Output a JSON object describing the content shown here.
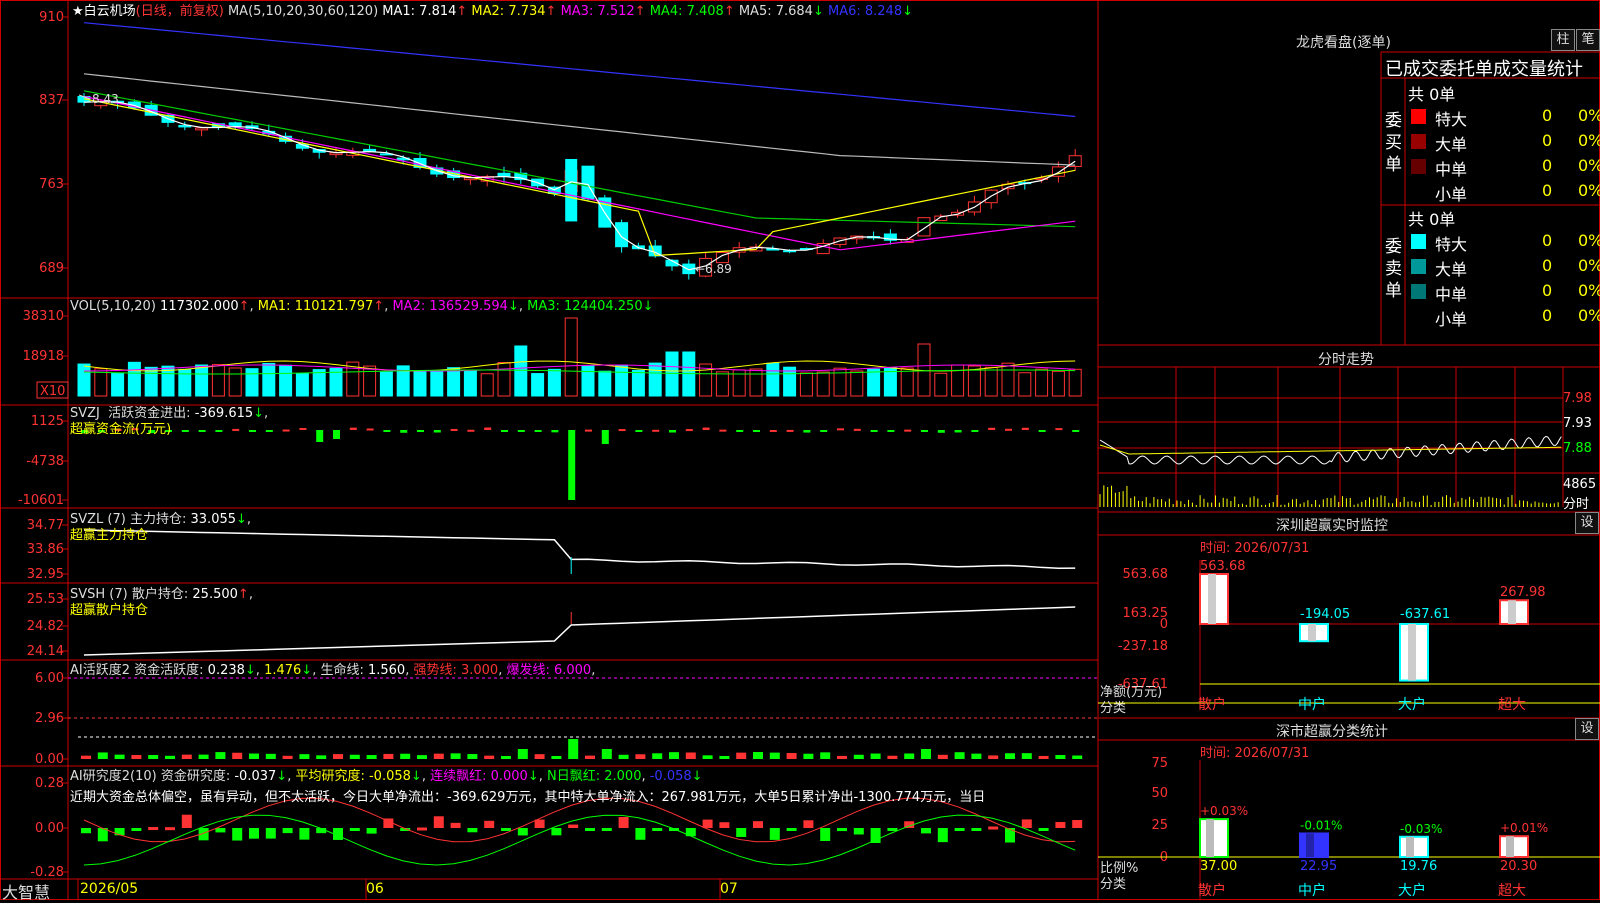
{
  "stock": {
    "title_star": "★",
    "name": "白云机场",
    "mode": "(日线，前复权)",
    "ma_label": "MA(5,10,20,30,60,120)",
    "ma_values": [
      {
        "label": "MA1:",
        "value": "7.814",
        "arrow": "↑",
        "color": "#ffffff"
      },
      {
        "label": "MA2:",
        "value": "7.734",
        "arrow": "↑",
        "color": "#ffff00"
      },
      {
        "label": "MA3:",
        "value": "7.512",
        "arrow": "↑",
        "color": "#ff00ff"
      },
      {
        "label": "MA4:",
        "value": "7.408",
        "arrow": "↑",
        "color": "#00ff00"
      },
      {
        "label": "MA5:",
        "value": "7.684",
        "arrow": "↓",
        "color": "#dddddd"
      },
      {
        "label": "MA6:",
        "value": "8.248",
        "arrow": "↓",
        "color": "#3333ff"
      }
    ],
    "y_ticks": [
      "910",
      "837",
      "763",
      "689"
    ],
    "high_mark": "8.43",
    "low_mark": "6.89"
  },
  "volume": {
    "header": "VOL(5,10,20)",
    "value": "117302.000",
    "ma1": "110121.797",
    "ma2": "136529.594",
    "ma3": "124404.250",
    "y_ticks": [
      "38310",
      "18918"
    ],
    "unit": "X10"
  },
  "svzj": {
    "header": "SVZJ",
    "label": "活跃资金进出:",
    "value": "-369.615",
    "sub": "超赢资金流(万元)",
    "y_ticks": [
      "1125",
      "-4738",
      "-10601"
    ]
  },
  "svzl": {
    "header": "SVZL (7)",
    "label": "主力持仓:",
    "value": "33.055",
    "sub": "超赢主力持仓",
    "y_ticks": [
      "34.77",
      "33.86",
      "32.95"
    ]
  },
  "svsh": {
    "header": "SVSH (7)",
    "label": "散户持仓:",
    "value": "25.500",
    "sub": "超赢散户持仓",
    "y_ticks": [
      "25.53",
      "24.82",
      "24.14"
    ]
  },
  "ai_active": {
    "header": "AI活跃度2",
    "label": "资金活跃度:",
    "v1": "0.238",
    "v2": "1.476",
    "life_label": "生命线:",
    "life": "1.560",
    "strong": "强势线: 3.000",
    "burst": "爆发线: 6.000",
    "y_ticks": [
      "6.00",
      "2.96",
      "0.00"
    ]
  },
  "ai_research": {
    "header": "AI研究度2(10)",
    "label": "资金研究度:",
    "v1": "-0.037",
    "avg_label": "平均研究度:",
    "avg": "-0.058",
    "red_label": "连续飘红:",
    "red": "0.000",
    "n_label": "N日飘红:",
    "n1": "2.000",
    "n2": "-0.058",
    "comment": "近期大资金总体偏空，虽有异动，但不太活跃，今日大单净流出：-369.629万元，其中特大单净流入：267.981万元，大单5日累计净出-1300.774万元，当日",
    "y_ticks": [
      "0.28",
      "0.00",
      "-0.28"
    ]
  },
  "bottom_bar": {
    "brand": "大智慧",
    "dates": [
      "2026/05",
      "06",
      "07"
    ]
  },
  "dragon": {
    "title": "龙虎看盘(逐单)",
    "btn1": "柱",
    "btn2": "笔",
    "subtitle": "已成交委托单成交量统计",
    "buy": {
      "side": "委买单",
      "total": "共 0单",
      "rows": [
        {
          "name": "特大",
          "count": "0",
          "pct": "0%",
          "color": "#ff0000"
        },
        {
          "name": "大单",
          "count": "0",
          "pct": "0%",
          "color": "#990000"
        },
        {
          "name": "中单",
          "count": "0",
          "pct": "0%",
          "color": "#660000"
        },
        {
          "name": "小单",
          "count": "0",
          "pct": "0%",
          "color": "#000000"
        }
      ]
    },
    "sell": {
      "side": "委卖单",
      "total": "共 0单",
      "rows": [
        {
          "name": "特大",
          "count": "0",
          "pct": "0%",
          "color": "#00ffff"
        },
        {
          "name": "大单",
          "count": "0",
          "pct": "0%",
          "color": "#009999"
        },
        {
          "name": "中单",
          "count": "0",
          "pct": "0%",
          "color": "#007777"
        },
        {
          "name": "小单",
          "count": "0",
          "pct": "0%",
          "color": "#000000"
        }
      ]
    }
  },
  "intraday": {
    "title": "分时走势",
    "prices": [
      "7.98",
      "7.93",
      "7.88"
    ],
    "vol": "4865",
    "vol_label": "分时"
  },
  "monitor": {
    "title": "深圳超赢实时监控",
    "btn": "设",
    "time": "时间: 2026/07/31",
    "y_ticks": [
      "563.68",
      "163.25",
      "0",
      "-237.18",
      "-637.61"
    ],
    "y_label1": "净额(万元)",
    "y_label2": "分类",
    "categories": [
      "散户",
      "中户",
      "大户",
      "超大"
    ],
    "values": [
      563.68,
      -194.05,
      -637.61,
      267.98
    ],
    "value_labels": [
      "563.68",
      "-194.05",
      "-637.61",
      "267.98"
    ]
  },
  "classify": {
    "title": "深市超赢分类统计",
    "btn": "设",
    "time": "时间: 2026/07/31",
    "y_ticks": [
      "75",
      "50",
      "25",
      "0"
    ],
    "y_label1": "比例%",
    "y_label2": "分类",
    "categories": [
      "散户",
      "中户",
      "大户",
      "超大"
    ],
    "values": [
      37.0,
      22.95,
      19.76,
      20.3
    ],
    "value_labels": [
      "37.00",
      "22.95",
      "19.76",
      "20.30"
    ],
    "changes": [
      "+0.03%",
      "-0.01%",
      "-0.03%",
      "+0.01%"
    ]
  },
  "chart_data": {
    "type": "bar",
    "title": "深圳超赢实时监控",
    "categories": [
      "散户",
      "中户",
      "大户",
      "超大"
    ],
    "series": [
      {
        "name": "净额(万元)",
        "values": [
          563.68,
          -194.05,
          -637.61,
          267.98
        ]
      },
      {
        "name": "比例%",
        "values": [
          37.0,
          22.95,
          19.76,
          20.3
        ]
      }
    ]
  }
}
